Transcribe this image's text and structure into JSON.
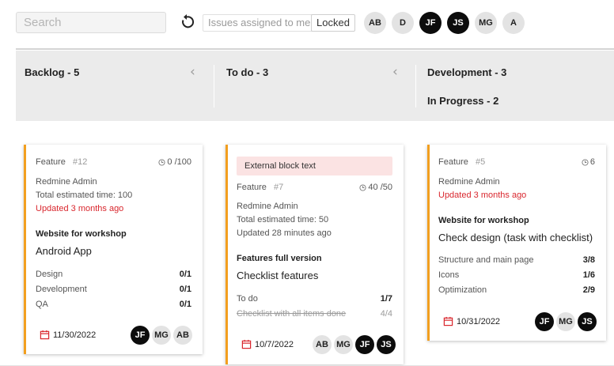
{
  "toolbar": {
    "search_placeholder": "Search",
    "filter_assignee_placeholder": "Issues assigned to me",
    "locked_label": "Locked",
    "users": [
      "AB",
      "D",
      "JF",
      "JS",
      "MG",
      "A"
    ]
  },
  "columns": [
    {
      "title": "Backlog - 5"
    },
    {
      "title": "To do - 3"
    },
    {
      "title": "Development - 3",
      "subtitle": "In Progress - 2"
    }
  ],
  "cards": [
    {
      "tracker": "Feature",
      "id": "#12",
      "time": "0 /100",
      "author": "Redmine Admin",
      "estimate": "Total estimated time: 100",
      "updated": "Updated 3 months ago",
      "project": "Website for workshop",
      "title": "Android App",
      "checklist": [
        {
          "label": "Design",
          "value": "0/1"
        },
        {
          "label": "Development",
          "value": "0/1"
        },
        {
          "label": "QA",
          "value": "0/1"
        }
      ],
      "date": "11/30/2022",
      "assignees": [
        "JF",
        "MG",
        "AB"
      ]
    },
    {
      "external": "External block text",
      "tracker": "Feature",
      "id": "#7",
      "time": "40 /50",
      "author": "Redmine Admin",
      "estimate": "Total estimated time: 50",
      "updated": "Updated 28 minutes ago",
      "project": "Features full version",
      "title": "Checklist features",
      "checklist": [
        {
          "label": "To do",
          "value": "1/7"
        },
        {
          "label": "Checklist with all items done",
          "value": "4/4"
        }
      ],
      "date": "10/7/2022",
      "assignees": [
        "AB",
        "MG",
        "JF",
        "JS"
      ]
    },
    {
      "tracker": "Feature",
      "id": "#5",
      "time": "6",
      "author": "Redmine Admin",
      "updated": "Updated 3 months ago",
      "project": "Website for workshop",
      "title": "Check design (task with checklist)",
      "checklist": [
        {
          "label": "Structure and main page",
          "value": "3/8"
        },
        {
          "label": "Icons",
          "value": "1/6"
        },
        {
          "label": "Optimization",
          "value": "2/9"
        }
      ],
      "date": "10/31/2022",
      "assignees": [
        "JF",
        "MG",
        "JS"
      ]
    }
  ],
  "colors": {
    "accent": "#f29f1f",
    "danger": "#d9272e",
    "header_bg": "#ebebeb"
  }
}
